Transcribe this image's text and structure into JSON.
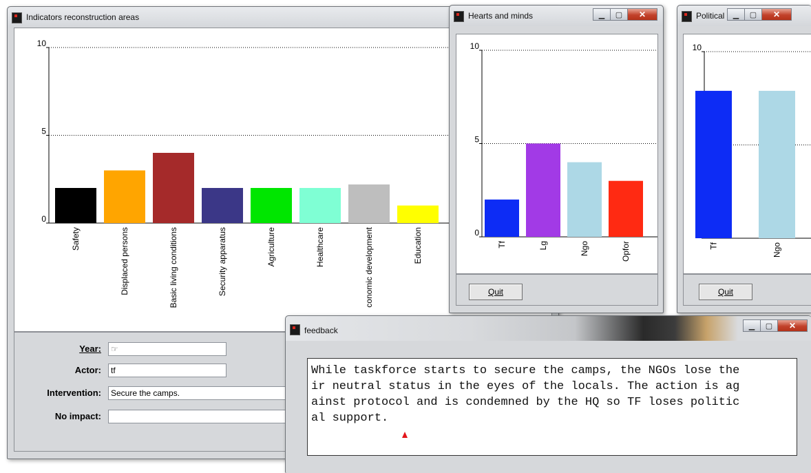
{
  "windows": {
    "main": {
      "title": "Indicators reconstruction areas",
      "form": {
        "year_label": "Year:",
        "year_value": "",
        "actor_label": "Actor:",
        "actor_value": "tf",
        "intervention_label": "Intervention:",
        "intervention_value": "Secure the camps.",
        "noimpact_label": "No impact:",
        "noimpact_value": ""
      }
    },
    "hearts": {
      "title": "Hearts and minds",
      "quit_label": "Quit"
    },
    "political": {
      "title": "Political ...",
      "quit_label": "Quit"
    },
    "feedback": {
      "title": "feedback",
      "lines": [
        "While taskforce starts to secure the camps, the NGOs lose the",
        "ir neutral status in the eyes of the locals. The action is ag",
        "ainst protocol and is condemned by the HQ so TF loses politic",
        "al support."
      ]
    }
  },
  "chart_data": [
    {
      "type": "bar",
      "title": "",
      "categories": [
        "Safety",
        "Displaced persons",
        "Basic living conditions",
        "Security apparatus",
        "Agriculture",
        "Healthcare",
        "conomic development",
        "Education"
      ],
      "values": [
        2,
        3,
        4,
        2,
        2,
        2,
        2.2,
        1
      ],
      "colors": [
        "#000000",
        "#ffa500",
        "#a52a2a",
        "#3b3787",
        "#00e600",
        "#7fffd4",
        "#bebebe",
        "#ffff00"
      ],
      "ylim": [
        0,
        10
      ],
      "yticks": [
        "0",
        "5",
        "10"
      ],
      "grid": "dotted at 5 and 10"
    },
    {
      "type": "bar",
      "title": "",
      "categories": [
        "Tf",
        "Lg",
        "Ngo",
        "Opfor"
      ],
      "values": [
        2,
        5,
        4,
        3
      ],
      "colors": [
        "#0d2cf5",
        "#a23ae6",
        "#add8e6",
        "#ff2a12"
      ],
      "ylim": [
        0,
        10
      ],
      "yticks": [
        "0",
        "5",
        "10"
      ],
      "grid": "dotted at 5 and 10"
    },
    {
      "type": "bar",
      "title": "",
      "categories": [
        "Tf",
        "Ngo"
      ],
      "values": [
        7.9,
        7.9
      ],
      "colors": [
        "#0d2cf5",
        "#add8e6"
      ],
      "ylim": [
        0,
        10
      ],
      "yticks": [
        "0",
        "5",
        "10"
      ],
      "grid": "dotted at 5 and 10"
    }
  ]
}
